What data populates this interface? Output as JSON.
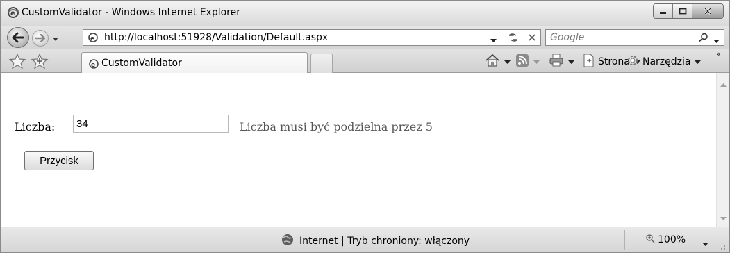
{
  "window": {
    "title": "CustomValidator - Windows Internet Explorer"
  },
  "address": {
    "url": "http://localhost:51928/Validation/Default.aspx"
  },
  "search": {
    "placeholder": "Google"
  },
  "tabs": [
    {
      "label": "CustomValidator"
    }
  ],
  "commands": {
    "page_label": "Strona",
    "tools_label": "Narzędzia",
    "more": "»"
  },
  "form": {
    "label": "Liczba:",
    "input_value": "34",
    "validator_message": "Liczba musi być podzielna przez 5",
    "button_label": "Przycisk"
  },
  "status": {
    "zone_text": "Internet | Tryb chroniony: włączony",
    "zoom": "100%"
  },
  "icons": {
    "browser": "ie-icon",
    "back": "back-arrow-icon",
    "forward": "forward-arrow-icon",
    "refresh": "refresh-icon",
    "stop": "stop-icon",
    "search": "search-icon",
    "favorites": "favorites-star-icon",
    "add_favorites": "add-favorites-icon",
    "home": "home-icon",
    "feeds": "rss-feed-icon",
    "print": "print-icon",
    "page": "page-icon",
    "tools": "gear-icon",
    "zone": "globe-icon",
    "zoom": "zoom-icon"
  }
}
